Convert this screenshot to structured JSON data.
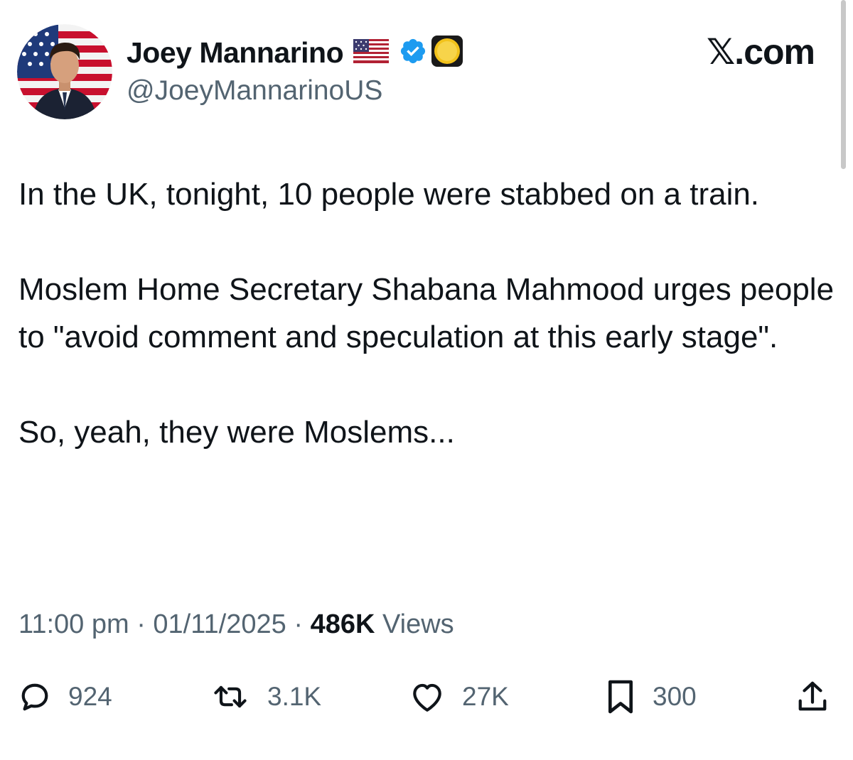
{
  "author": {
    "display_name": "Joey Mannarino",
    "handle": "@JoeyMannarinoUS",
    "avatar_icon": "profile-photo-flag-background",
    "badges": [
      "us-flag-icon",
      "verified-badge-icon",
      "yellow-circle-icon"
    ]
  },
  "brand": "𝕏.com",
  "tweet": {
    "paragraphs": [
      "In the UK, tonight, 10 people were stabbed on a train.",
      "Moslem Home Secretary Shabana Mahmood urges people to \"avoid comment and speculation at this early stage\".",
      "So, yeah, they were Moslems..."
    ]
  },
  "meta": {
    "time": "11:00 pm",
    "separator": "·",
    "date": "01/11/2025",
    "views_count": "486K",
    "views_label": "Views"
  },
  "actions": {
    "replies": "924",
    "reposts": "3.1K",
    "likes": "27K",
    "bookmarks": "300"
  },
  "colors": {
    "text": "#0f1419",
    "secondary": "#536471",
    "verified": "#1d9bf0"
  }
}
